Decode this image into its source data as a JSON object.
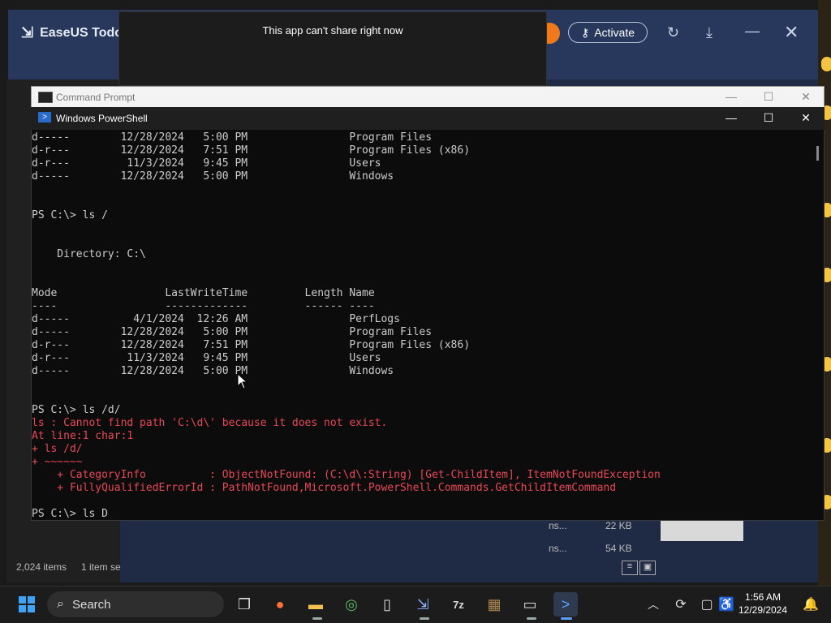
{
  "easeus": {
    "brand": "EaseUS Todo",
    "activate_label": "Activate"
  },
  "share_toast": {
    "message": "This app can't share right now"
  },
  "cmd_window": {
    "title": "Command Prompt"
  },
  "ps_window": {
    "title": "Windows PowerShell"
  },
  "console_lines": [
    {
      "text": "d-----        12/28/2024   5:00 PM                Program Files",
      "err": false
    },
    {
      "text": "d-r---        12/28/2024   7:51 PM                Program Files (x86)",
      "err": false
    },
    {
      "text": "d-r---         11/3/2024   9:45 PM                Users",
      "err": false
    },
    {
      "text": "d-----        12/28/2024   5:00 PM                Windows",
      "err": false
    },
    {
      "text": "",
      "err": false
    },
    {
      "text": "",
      "err": false
    },
    {
      "text": "PS C:\\> ls /",
      "err": false
    },
    {
      "text": "",
      "err": false
    },
    {
      "text": "",
      "err": false
    },
    {
      "text": "    Directory: C:\\",
      "err": false
    },
    {
      "text": "",
      "err": false
    },
    {
      "text": "",
      "err": false
    },
    {
      "text": "Mode                 LastWriteTime         Length Name",
      "err": false
    },
    {
      "text": "----                 -------------         ------ ----",
      "err": false
    },
    {
      "text": "d-----          4/1/2024  12:26 AM                PerfLogs",
      "err": false
    },
    {
      "text": "d-----        12/28/2024   5:00 PM                Program Files",
      "err": false
    },
    {
      "text": "d-r---        12/28/2024   7:51 PM                Program Files (x86)",
      "err": false
    },
    {
      "text": "d-r---         11/3/2024   9:45 PM                Users",
      "err": false
    },
    {
      "text": "d-----        12/28/2024   5:00 PM                Windows",
      "err": false
    },
    {
      "text": "",
      "err": false
    },
    {
      "text": "",
      "err": false
    },
    {
      "text": "PS C:\\> ls /d/",
      "err": false
    },
    {
      "text": "ls : Cannot find path 'C:\\d\\' because it does not exist.",
      "err": true
    },
    {
      "text": "At line:1 char:1",
      "err": true
    },
    {
      "text": "+ ls /d/",
      "err": true
    },
    {
      "text": "+ ~~~~~~",
      "err": true
    },
    {
      "text": "    + CategoryInfo          : ObjectNotFound: (C:\\d\\:String) [Get-ChildItem], ItemNotFoundException",
      "err": true
    },
    {
      "text": "    + FullyQualifiedErrorId : PathNotFound,Microsoft.PowerShell.Commands.GetChildItemCommand",
      "err": true
    },
    {
      "text": "",
      "err": false
    },
    {
      "text": "PS C:\\> ls D",
      "err": false
    }
  ],
  "explorer": {
    "item_count": "2,024 items",
    "selection": "1 item se",
    "size1": "22 KB",
    "size2": "54 KB",
    "name_frag1": "ns...",
    "name_frag2": "ns..."
  },
  "taskbar": {
    "search_label": "Search",
    "time": "1:56 AM",
    "date": "12/29/2024"
  },
  "icons": [
    "windows-start-icon",
    "search-icon",
    "task-view-icon",
    "firefox-icon",
    "file-explorer-icon",
    "app-icon",
    "phone-icon",
    "easeus-icon",
    "7zip-icon",
    "archive-icon",
    "terminal-icon",
    "powershell-icon",
    "chevron-up-icon",
    "sync-icon",
    "display-icon",
    "accessibility-icon",
    "notification-bell-icon"
  ],
  "colors": {
    "console_bg": "#0c0c0c",
    "error_text": "#e74856",
    "accent_orange": "#f07a1a"
  }
}
